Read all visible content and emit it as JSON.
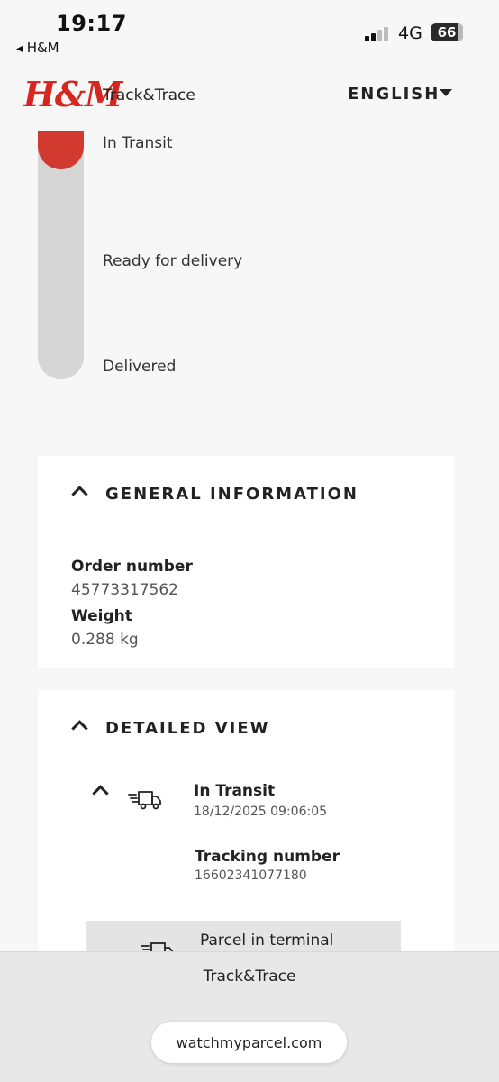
{
  "status_bar": {
    "time": "19:17",
    "back_label": "H&M",
    "network": "4G",
    "battery": "66"
  },
  "header": {
    "logo": "H&M",
    "title": "Track&Trace",
    "language": "ENGLISH"
  },
  "progress": {
    "steps": [
      {
        "label": "In Transit",
        "active": true
      },
      {
        "label": "Ready for delivery",
        "active": false
      },
      {
        "label": "Delivered",
        "active": false
      }
    ],
    "accent": "#d23a30"
  },
  "general": {
    "title": "GENERAL INFORMATION",
    "fields": [
      {
        "label": "Order number",
        "value": "45773317562"
      },
      {
        "label": "Weight",
        "value": "0.288 kg"
      }
    ]
  },
  "detailed": {
    "title": "DETAILED VIEW",
    "events": [
      {
        "status": "In Transit",
        "datetime": "18/12/2025 09:06:05",
        "tracking_label": "Tracking number",
        "tracking_value": "16602341077180"
      },
      {
        "status": "Parcel in terminal"
      }
    ]
  },
  "browser": {
    "page_title": "Track&Trace",
    "url": "watchmyparcel.com"
  }
}
